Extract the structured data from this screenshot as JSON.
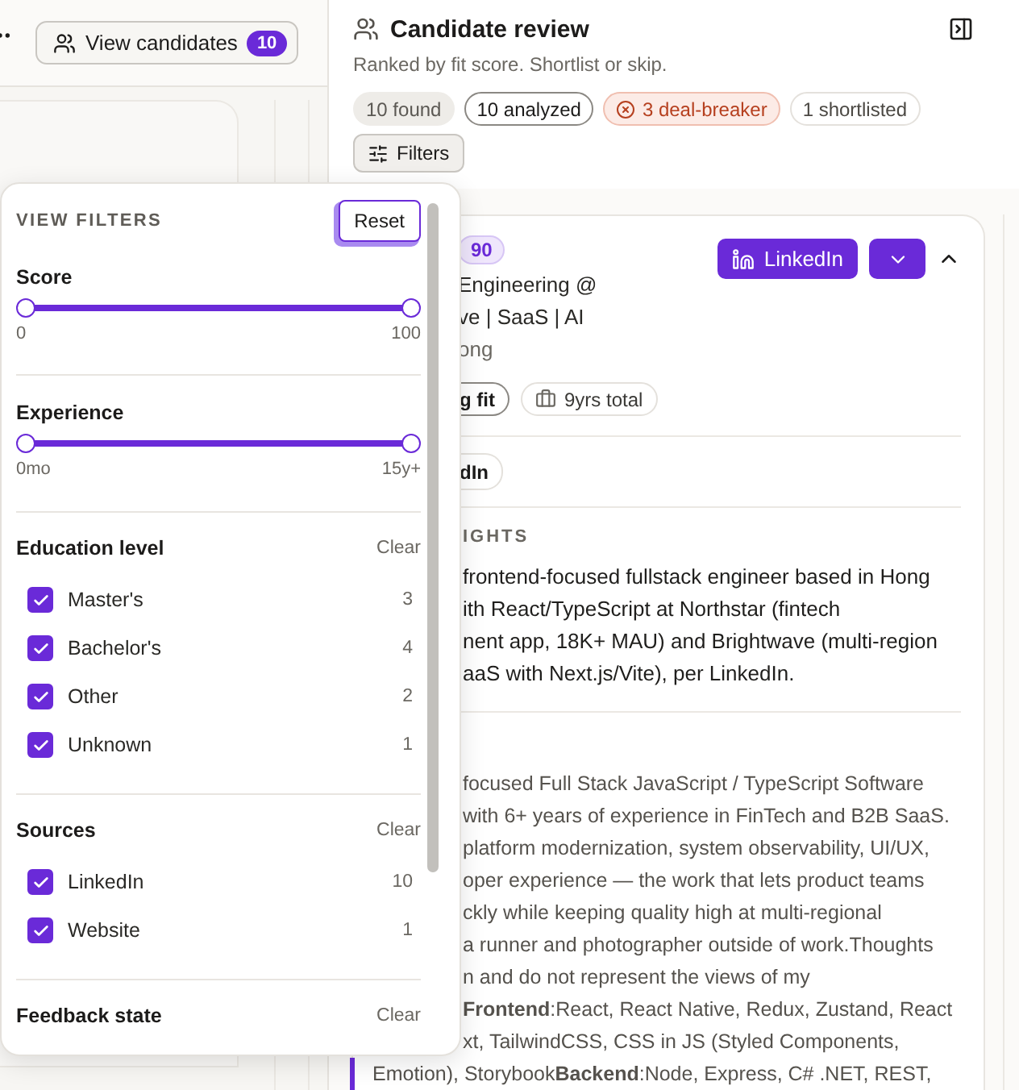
{
  "left_header": {
    "button": {
      "label": "View candidates",
      "count": "10"
    }
  },
  "panel": {
    "title": "Candidate review",
    "subtitle": "Ranked by fit score. Shortlist or skip.",
    "chips": [
      {
        "label": "10 found",
        "kind": "muted"
      },
      {
        "label": "10 analyzed",
        "kind": "outlined"
      },
      {
        "label": "3 deal-breaker",
        "kind": "danger"
      },
      {
        "label": "1 shortlisted",
        "kind": "plain"
      }
    ],
    "filters_button": "Filters"
  },
  "candidate": {
    "score": "90",
    "expanded": true,
    "linkedin_button": "LinkedIn",
    "headline_lines": [
      "Engineering @",
      "ve | SaaS | AI"
    ],
    "location": "ong",
    "tags": [
      {
        "label": "g fit",
        "kind": "fit"
      },
      {
        "label": "9yrs total",
        "kind": "experience"
      }
    ],
    "source": "dIn",
    "insights": {
      "heading": "IGHTS",
      "lines": [
        "frontend-focused fullstack engineer based in Hong",
        "ith React/TypeScript at Northstar (fintech",
        "nent app, 18K+ MAU) and Brightwave (multi-region",
        "aaS with Next.js/Vite), per LinkedIn."
      ]
    },
    "about_lines": [
      "focused Full Stack JavaScript / TypeScript Software",
      "with 6+ years of experience in FinTech and B2B SaaS.",
      "platform modernization, system observability, UI/UX,",
      "oper experience — the work that lets product teams",
      "ckly while keeping quality high at multi-regional",
      "a runner and photographer outside of work.Thoughts",
      "n and do not represent the views of my",
      "**Frontend**:React, React Native, Redux, Zustand, React",
      "xt, TailwindCSS, CSS in JS (Styled Components,"
    ],
    "about_tail": "Emotion), Storybook**Backend**:Node, Express, C# .NET, REST,"
  },
  "filters": {
    "title": "VIEW FILTERS",
    "reset": "Reset",
    "ranges": [
      {
        "label": "Score",
        "min": "0",
        "max": "100",
        "low": {
          "level": 0
        },
        "high": {
          "level": 1
        }
      },
      {
        "label": "Experience",
        "min": "0mo",
        "max": "15y+",
        "low": {
          "level": 0
        },
        "high": {
          "level": 1
        }
      }
    ],
    "groups": [
      {
        "title": "Education level",
        "clear": "Clear",
        "options": [
          {
            "label": "Master's",
            "count": "3",
            "checked": true
          },
          {
            "label": "Bachelor's",
            "count": "4",
            "checked": true
          },
          {
            "label": "Other",
            "count": "2",
            "checked": true
          },
          {
            "label": "Unknown",
            "count": "1",
            "checked": true
          }
        ]
      },
      {
        "title": "Sources",
        "clear": "Clear",
        "options": [
          {
            "label": "LinkedIn",
            "count": "10",
            "checked": true
          },
          {
            "label": "Website",
            "count": "1",
            "checked": true
          }
        ]
      },
      {
        "title": "Feedback state",
        "clear": "Clear"
      }
    ]
  }
}
